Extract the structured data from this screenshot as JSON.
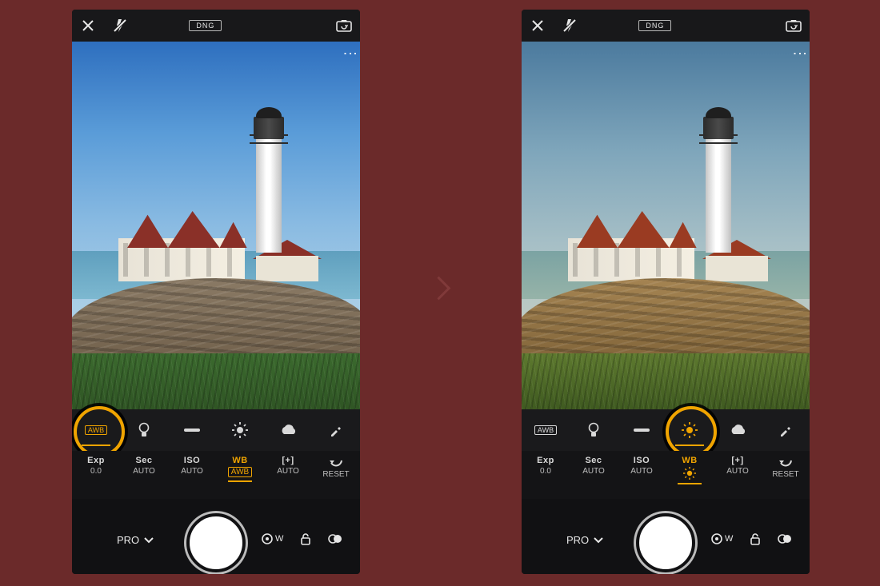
{
  "topbar": {
    "format": "DNG"
  },
  "wb": {
    "awb_label": "AWB",
    "items": [
      "awb",
      "incandescent",
      "fluorescent",
      "daylight",
      "cloudy",
      "eyedropper"
    ]
  },
  "settings": {
    "exp": {
      "label": "Exp",
      "value": "0.0"
    },
    "sec": {
      "label": "Sec",
      "value": "AUTO"
    },
    "iso": {
      "label": "ISO",
      "value": "AUTO"
    },
    "wb": {
      "label": "WB",
      "value_awb": "AWB"
    },
    "focus": {
      "label": "[+]",
      "value": "AUTO"
    },
    "reset": {
      "label": "RESET"
    }
  },
  "bottom": {
    "mode": "PRO",
    "wide": "W"
  },
  "left": {
    "wb_selected": "awb",
    "setting_selected": "wb",
    "setting_wb_mode": "awb"
  },
  "right": {
    "wb_selected": "daylight",
    "setting_selected": "wb",
    "setting_wb_mode": "daylight"
  }
}
